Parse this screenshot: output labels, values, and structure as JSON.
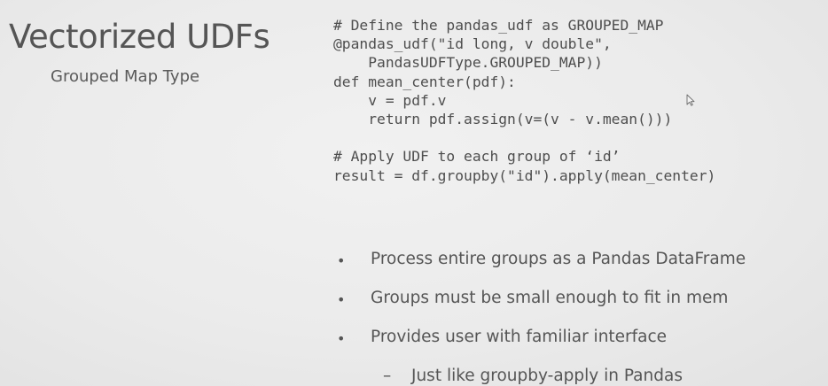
{
  "slide": {
    "title": "Vectorized UDFs",
    "subtitle": "Grouped Map Type",
    "code_lines": [
      "# Define the pandas_udf as GROUPED_MAP",
      "@pandas_udf(\"id long, v double\",",
      "    PandasUDFType.GROUPED_MAP))",
      "def mean_center(pdf):",
      "    v = pdf.v",
      "    return pdf.assign(v=(v - v.mean()))",
      "",
      "# Apply UDF to each group of ‘id’",
      "result = df.groupby(\"id\").apply(mean_center)"
    ],
    "bullets": [
      "Process entire groups as a Pandas DataFrame",
      "Groups must be small enough to fit in mem",
      "Provides user with familiar interface"
    ],
    "sub_bullets": [
      "Just like groupby-apply in Pandas"
    ],
    "bullet_marker": "•",
    "sub_bullet_marker": "–"
  },
  "icons": {
    "cursor": "mouse-pointer-icon"
  }
}
